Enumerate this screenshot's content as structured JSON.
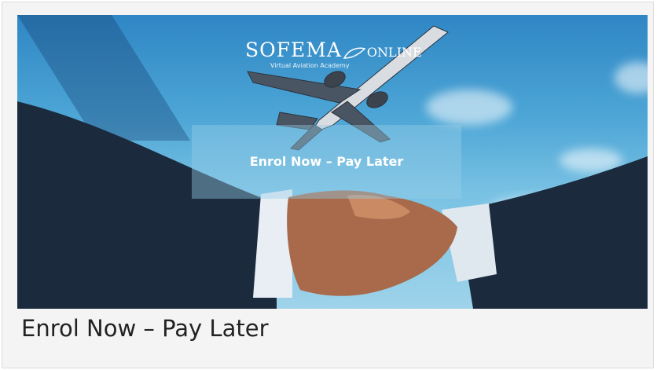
{
  "brand": {
    "name": "SOFEMA",
    "suffix": "ONLINE",
    "tagline": "Virtual Aviation Academy"
  },
  "banner": {
    "cta_text": "Enrol Now – Pay Later",
    "image_subject": "business handshake with airplane in sky"
  },
  "caption": "Enrol Now – Pay Later",
  "colors": {
    "sky_top": "#2f86c4",
    "sky_bottom": "#9ed3ea",
    "suit": "#1b2a3d",
    "skin": "#a86a4a"
  },
  "icons": [
    "leaf-logo-icon",
    "airplane-illustration",
    "handshake-illustration"
  ]
}
